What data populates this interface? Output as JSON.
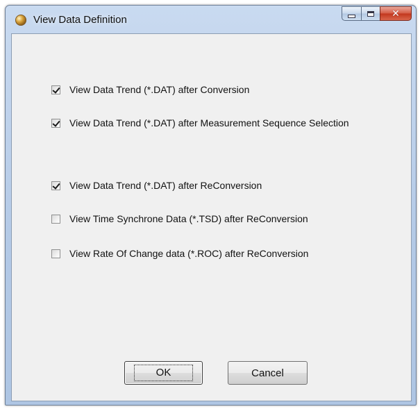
{
  "window": {
    "title": "View Data Definition",
    "icon": "app-globe-icon"
  },
  "caption_buttons": {
    "minimize": "minimize-icon",
    "maximize": "maximize-icon",
    "close": "✕"
  },
  "options": [
    {
      "label": "View Data Trend  (*.DAT) after Conversion",
      "checked": true
    },
    {
      "label": "View Data Trend  (*.DAT) after Measurement Sequence Selection",
      "checked": true
    },
    {
      "label": "View Data Trend  (*.DAT) after ReConversion",
      "checked": true
    },
    {
      "label": "View Time Synchrone Data  (*.TSD) after ReConversion",
      "checked": false
    },
    {
      "label": "View Rate Of Change data  (*.ROC) after ReConversion",
      "checked": false
    }
  ],
  "buttons": {
    "ok": "OK",
    "cancel": "Cancel"
  }
}
